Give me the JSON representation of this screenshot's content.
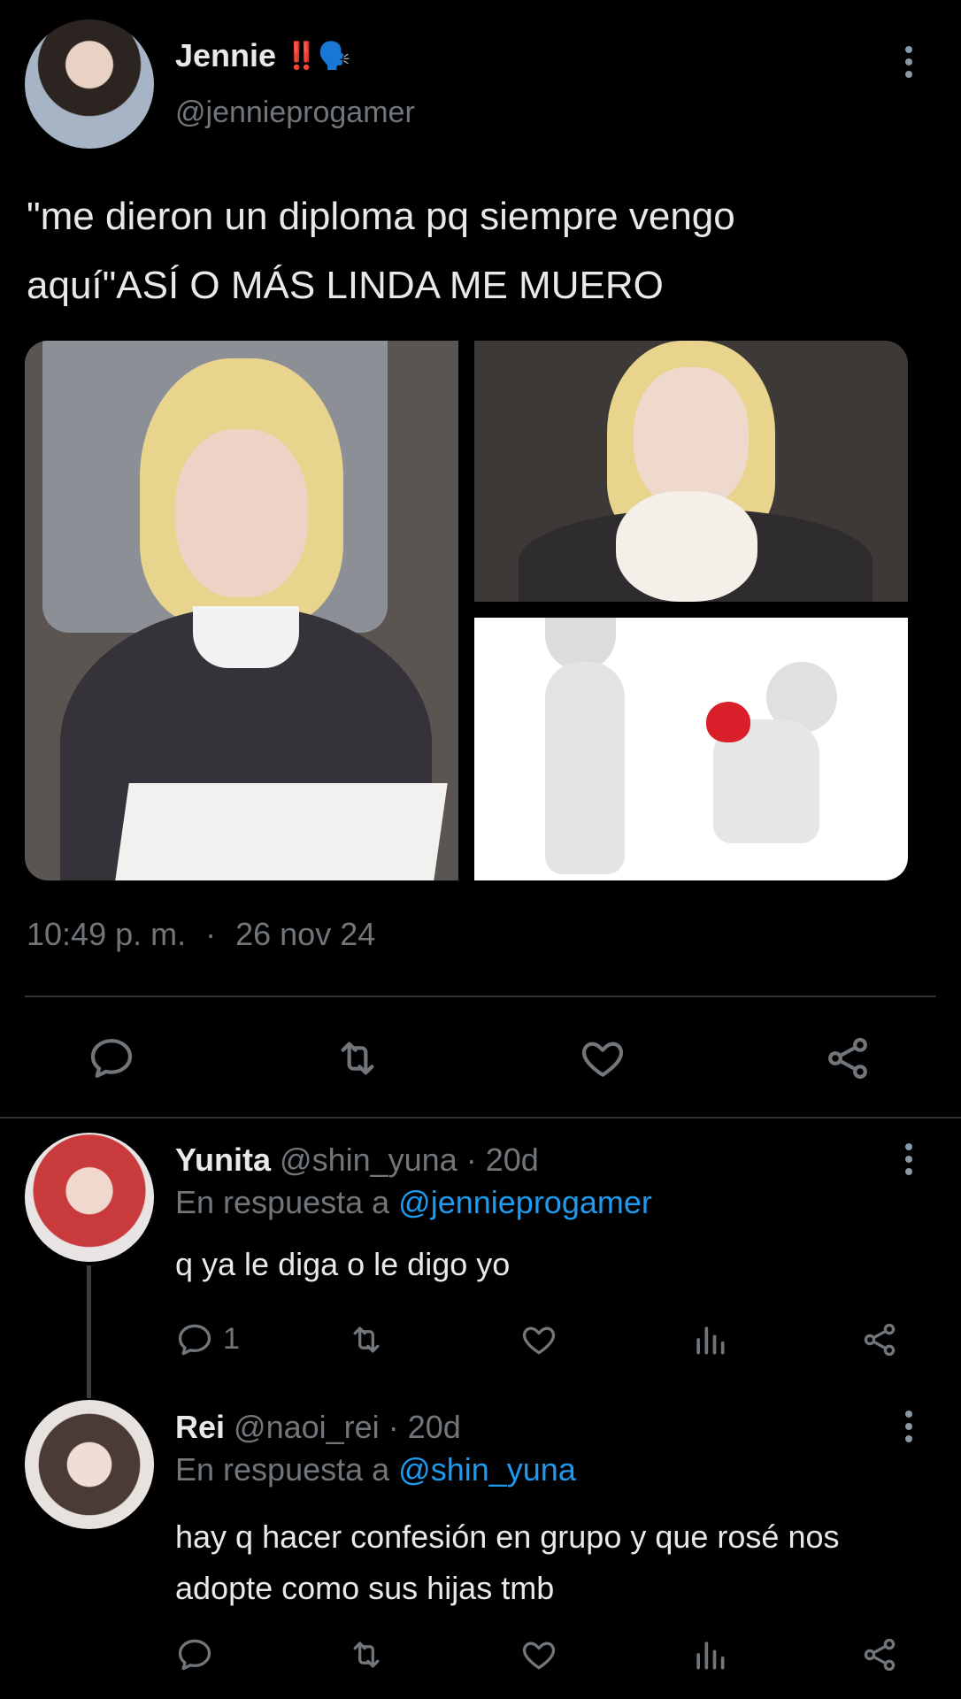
{
  "tweet": {
    "author_name": "Jennie",
    "author_emoji": "‼️🗣️",
    "author_handle": "@jennieprogamer",
    "text_line1": "\"me dieron un diploma pq siempre vengo",
    "text_line2": "aquí\"ASÍ O MÁS LINDA ME MUERO",
    "time": "10:49 p. m.",
    "separator": "·",
    "date": "26 nov 24"
  },
  "replies": [
    {
      "name": "Yunita",
      "handle": "@shin_yuna",
      "sep": "·",
      "age": "20d",
      "reply_prefix": "En respuesta a",
      "reply_to": "@jennieprogamer",
      "text_lines": [
        "q ya le diga o le digo yo"
      ],
      "reply_count": "1"
    },
    {
      "name": "Rei",
      "handle": "@naoi_rei",
      "sep": "·",
      "age": "20d",
      "reply_prefix": "En respuesta a",
      "reply_to": "@shin_yuna",
      "text_lines": [
        "hay q hacer confesión en grupo y que rosé nos",
        "adopte como sus hijas tmb"
      ],
      "reply_count": ""
    }
  ],
  "icons": {
    "main_actions": [
      "reply-icon",
      "retweet-icon",
      "like-icon",
      "share-icon"
    ],
    "reply_actions": [
      "reply-icon",
      "retweet-icon",
      "like-icon",
      "stats-icon",
      "share-icon"
    ]
  },
  "colors": {
    "background": "#000000",
    "text": "#e7e9ea",
    "muted": "#71767b",
    "link": "#1d9bf0",
    "divider": "#2f3336"
  }
}
